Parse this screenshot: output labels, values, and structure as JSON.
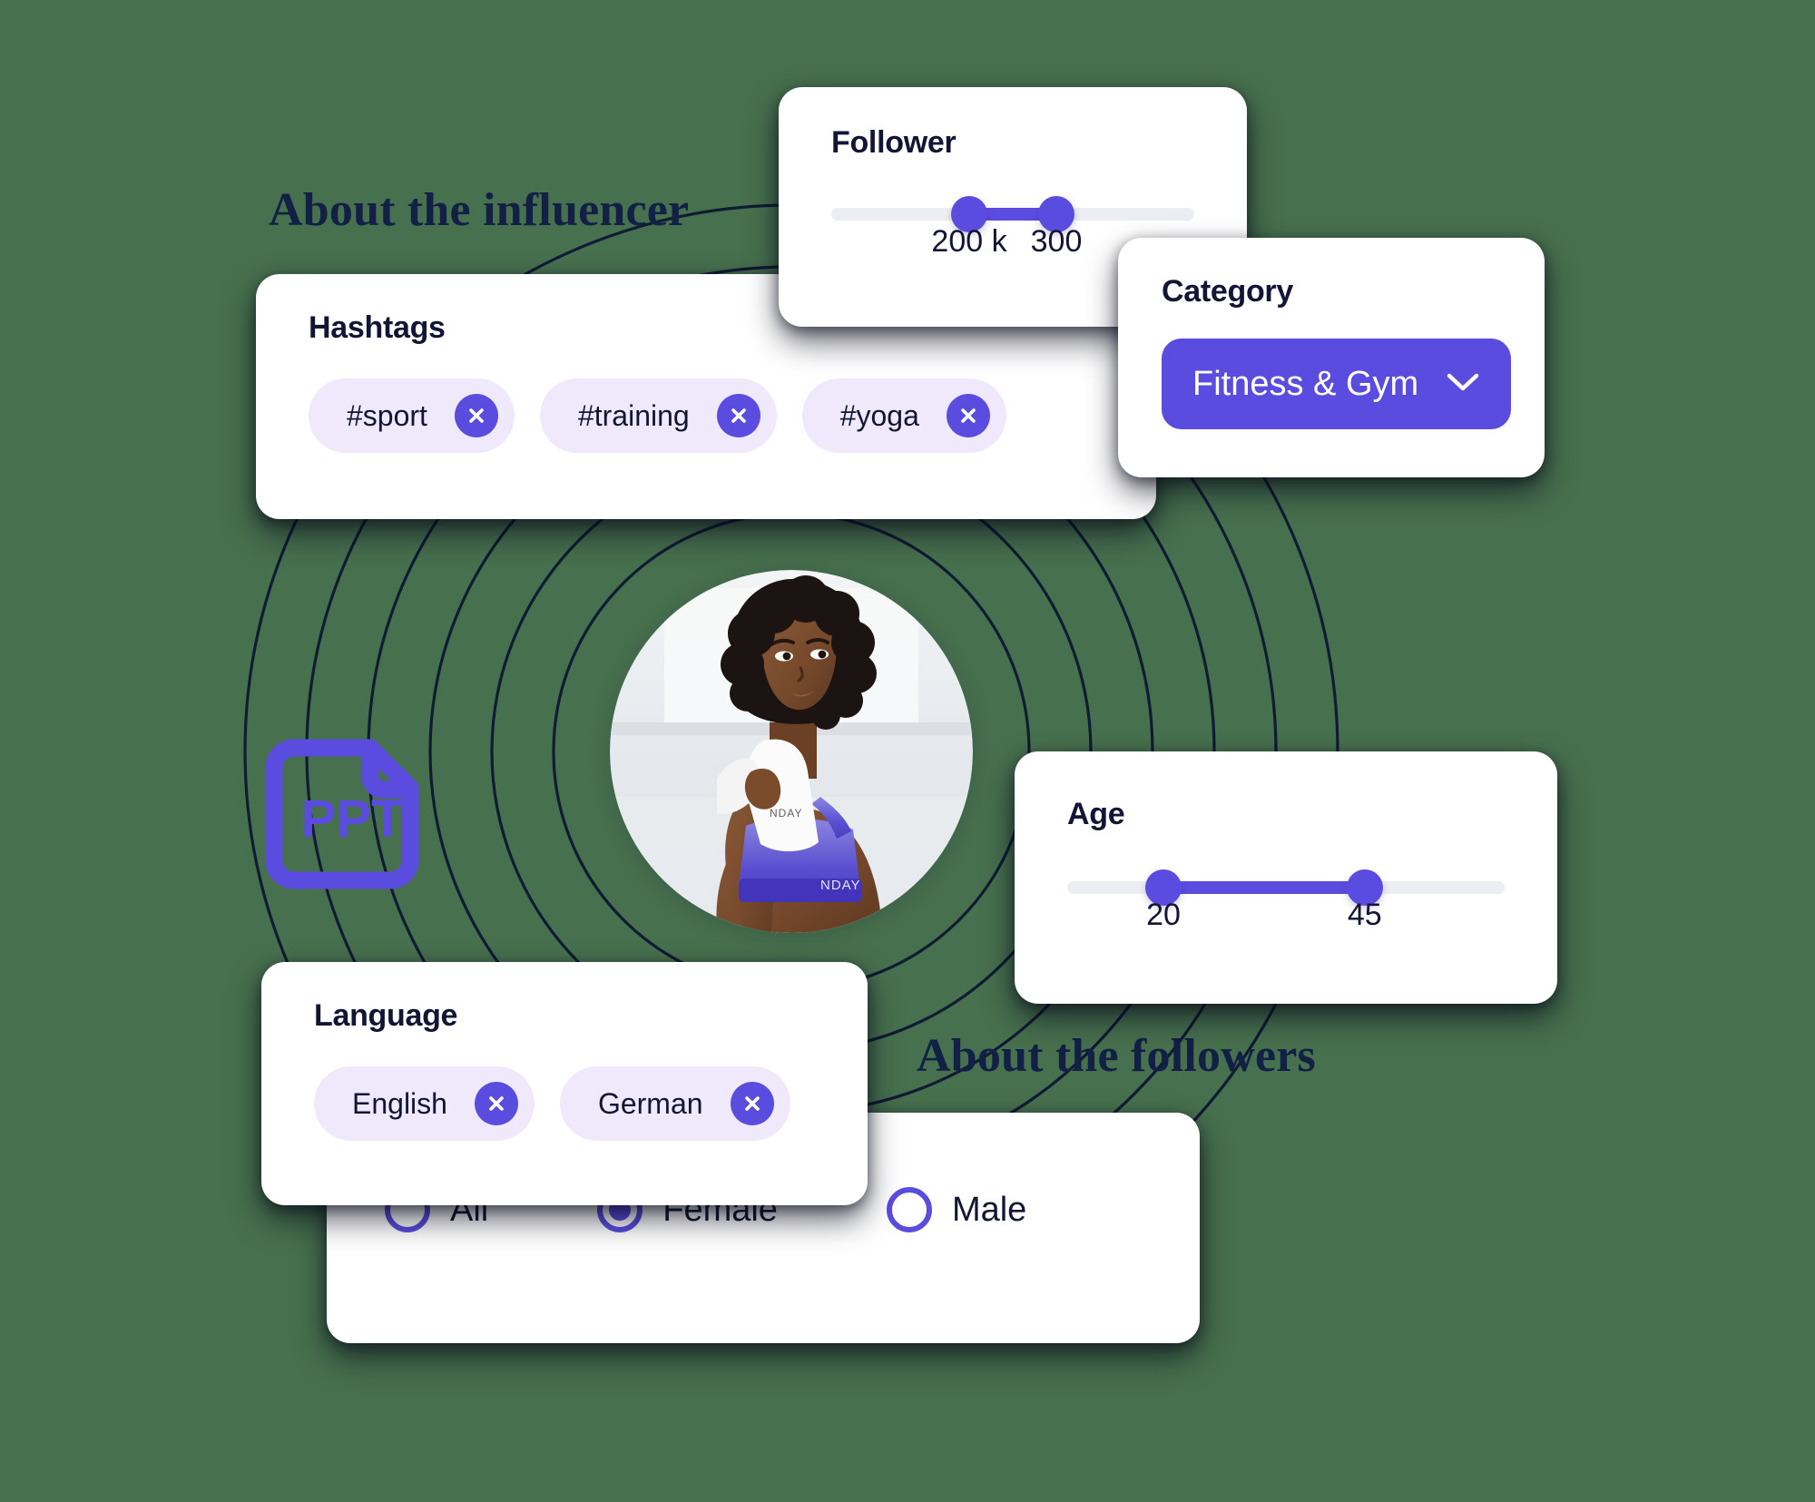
{
  "theme": {
    "background": "#47704E",
    "card_background": "#ffffff",
    "accent_purple": "#5B4CE0",
    "chip_background": "#EFE9FB",
    "text_dark": "#121634",
    "heading_navy": "#122046",
    "track_grey": "#eceef3"
  },
  "headings": {
    "influencer": "About the influencer",
    "followers": "About the followers"
  },
  "follower_card": {
    "title": "Follower",
    "slider": {
      "min_label": "200 k",
      "max_label": "300",
      "min_pct": 38,
      "max_pct": 62
    }
  },
  "category_card": {
    "title": "Category",
    "selected": "Fitness & Gym",
    "chevron_icon": "chevron-down-icon"
  },
  "hashtags_card": {
    "title": "Hashtags",
    "chips": [
      {
        "label": "#sport",
        "remove_icon": "close-icon"
      },
      {
        "label": "#training",
        "remove_icon": "close-icon"
      },
      {
        "label": "#yoga",
        "remove_icon": "close-icon"
      }
    ]
  },
  "age_card": {
    "title": "Age",
    "slider": {
      "min_label": "20",
      "max_label": "45",
      "min_pct": 22,
      "max_pct": 68
    }
  },
  "language_card": {
    "title": "Language",
    "chips": [
      {
        "label": "English",
        "remove_icon": "close-icon"
      },
      {
        "label": "German",
        "remove_icon": "close-icon"
      }
    ]
  },
  "gender_card": {
    "options": [
      {
        "label": "All",
        "selected": false
      },
      {
        "label": "Female",
        "selected": true
      },
      {
        "label": "Male",
        "selected": false
      }
    ]
  },
  "ppt_icon": {
    "name": "ppt-file-icon",
    "label": "PPT"
  },
  "center_photo": {
    "name": "influencer-avatar",
    "alt": "Woman in purple sports bra holding a white towel"
  }
}
